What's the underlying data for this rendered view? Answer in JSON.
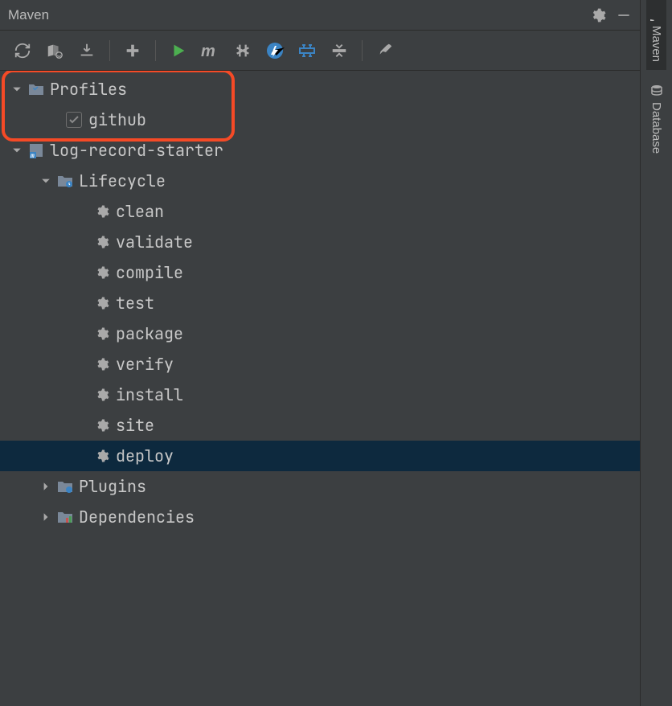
{
  "header": {
    "title": "Maven"
  },
  "rail": {
    "maven": "Maven",
    "database": "Database"
  },
  "tree": {
    "profiles": "Profiles",
    "github": "github",
    "project": "log-record-starter",
    "lifecycle": "Lifecycle",
    "goals": {
      "clean": "clean",
      "validate": "validate",
      "compile": "compile",
      "test": "test",
      "package": "package",
      "verify": "verify",
      "install": "install",
      "site": "site",
      "deploy": "deploy"
    },
    "plugins": "Plugins",
    "dependencies": "Dependencies"
  }
}
